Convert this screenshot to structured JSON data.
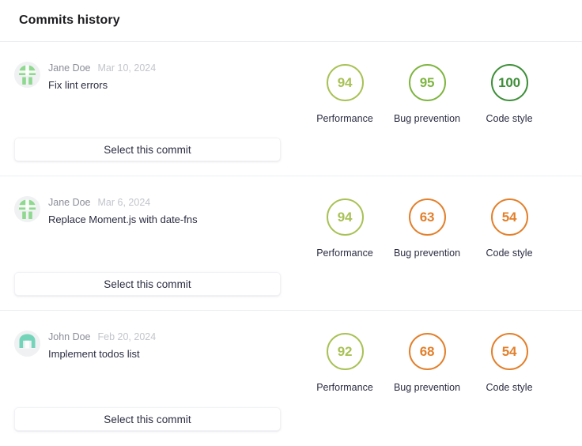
{
  "header": {
    "title": "Commits history"
  },
  "colors": {
    "score_high": "#3f8f3a",
    "score_good": "#7fb541",
    "score_ok": "#a8c256",
    "score_low": "#e2802c",
    "panel_border": "#eceef1",
    "title_text": "#1d1d20",
    "author_text": "#8b8d98",
    "date_text": "#c3c5cc",
    "message_text": "#2b2d42",
    "avatar_bg": "#f0f1f3"
  },
  "metric_labels": {
    "performance": "Performance",
    "bug_prevention": "Bug prevention",
    "code_style": "Code style"
  },
  "select_button_label": "Select this commit",
  "commits": [
    {
      "author": "Jane Doe",
      "date": "Mar 10, 2024",
      "message": "Fix lint errors",
      "avatar_icon": "avatar-jane-doe-icon",
      "avatar_color": "#7ed47e",
      "select_label": "Select this commit",
      "metrics": [
        {
          "label": "Performance",
          "value": "94",
          "color": "#a8c256",
          "name": "performance"
        },
        {
          "label": "Bug prevention",
          "value": "95",
          "color": "#7fb541",
          "name": "bug-prevention"
        },
        {
          "label": "Code style",
          "value": "100",
          "color": "#3f8f3a",
          "name": "code-style"
        }
      ]
    },
    {
      "author": "Jane Doe",
      "date": "Mar 6, 2024",
      "message": "Replace Moment.js with date-fns",
      "avatar_icon": "avatar-jane-doe-icon",
      "avatar_color": "#7ed47e",
      "select_label": "Select this commit",
      "metrics": [
        {
          "label": "Performance",
          "value": "94",
          "color": "#a8c256",
          "name": "performance"
        },
        {
          "label": "Bug prevention",
          "value": "63",
          "color": "#e2802c",
          "name": "bug-prevention"
        },
        {
          "label": "Code style",
          "value": "54",
          "color": "#e2802c",
          "name": "code-style"
        }
      ]
    },
    {
      "author": "John Doe",
      "date": "Feb 20, 2024",
      "message": "Implement todos list",
      "avatar_icon": "avatar-john-doe-icon",
      "avatar_color": "#5ecfae",
      "select_label": "Select this commit",
      "metrics": [
        {
          "label": "Performance",
          "value": "92",
          "color": "#a8c256",
          "name": "performance"
        },
        {
          "label": "Bug prevention",
          "value": "68",
          "color": "#e2802c",
          "name": "bug-prevention"
        },
        {
          "label": "Code style",
          "value": "54",
          "color": "#e2802c",
          "name": "code-style"
        }
      ]
    }
  ]
}
